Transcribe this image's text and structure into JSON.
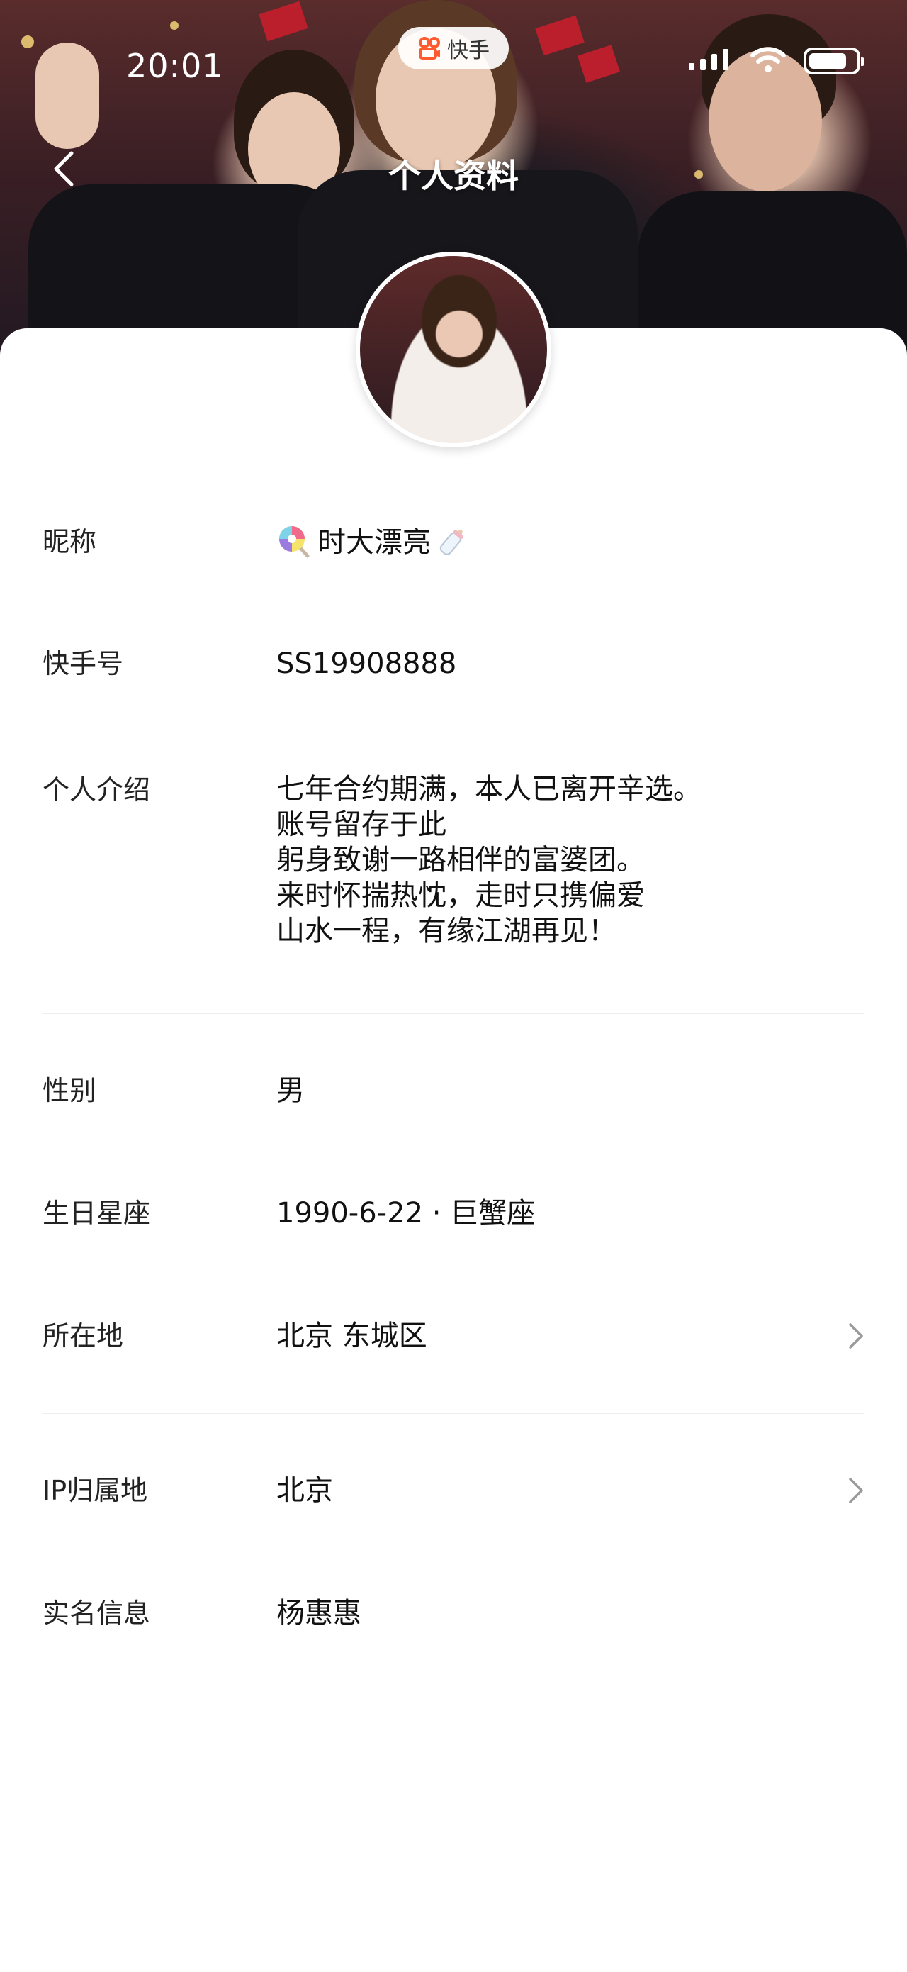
{
  "status_bar": {
    "time": "20:01"
  },
  "app_badge": {
    "label": "快手"
  },
  "header": {
    "title": "个人资料"
  },
  "profile": {
    "nickname": {
      "label": "昵称",
      "value": "时大漂亮"
    },
    "kuaishou_id": {
      "label": "快手号",
      "value": "SS19908888"
    },
    "bio": {
      "label": "个人介绍",
      "lines": [
        "七年合约期满，本人已离开辛选。",
        "账号留存于此",
        "躬身致谢一路相伴的富婆团。",
        "来时怀揣热忱，走时只携偏爱",
        "山水一程，有缘江湖再见！"
      ]
    },
    "gender": {
      "label": "性别",
      "value": "男"
    },
    "birthday": {
      "label": "生日星座",
      "value": "1990-6-22 · 巨蟹座"
    },
    "location": {
      "label": "所在地",
      "value": "北京 东城区"
    },
    "ip_location": {
      "label": "IP归属地",
      "value": "北京"
    },
    "real_name": {
      "label": "实名信息",
      "value": "杨惠惠"
    }
  }
}
